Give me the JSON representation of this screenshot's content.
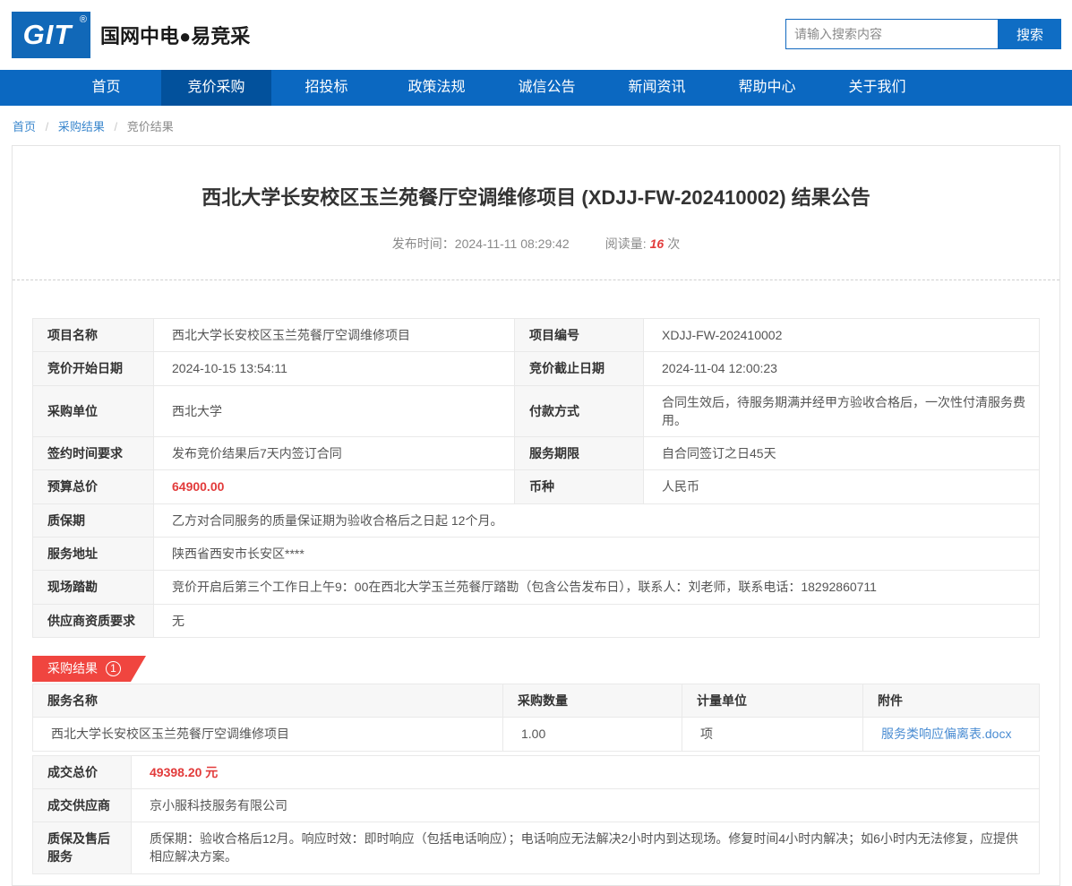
{
  "colors": {
    "nav_blue": "#0b68c1",
    "nav_active_blue": "#02519c",
    "logo_blue": "#1168b8",
    "accent_red": "#e23b3b",
    "ribbon_red": "#f0453f",
    "link_blue": "#4a8cd2"
  },
  "header": {
    "logo_text": "GIT",
    "logo_reg": "®",
    "brand": "国网中电●易竞采",
    "search_placeholder": "请输入搜索内容",
    "search_button": "搜索"
  },
  "nav": {
    "items": [
      {
        "label": "首页"
      },
      {
        "label": "竞价采购"
      },
      {
        "label": "招投标"
      },
      {
        "label": "政策法规"
      },
      {
        "label": "诚信公告"
      },
      {
        "label": "新闻资讯"
      },
      {
        "label": "帮助中心"
      },
      {
        "label": "关于我们"
      }
    ]
  },
  "breadcrumb": {
    "home": "首页",
    "sep1": "/",
    "middle": "采购结果",
    "sep2": "/",
    "current": "竞价结果"
  },
  "article": {
    "title": "西北大学长安校区玉兰苑餐厅空调维修项目 (XDJJ-FW-202410002) 结果公告",
    "publish_label": "发布时间：",
    "publish_time": "2024-11-11 08:29:42",
    "views_label": "阅读量:",
    "views_count": "16",
    "views_unit": "次"
  },
  "info": {
    "project_name_label": "项目名称",
    "project_name": "西北大学长安校区玉兰苑餐厅空调维修项目",
    "project_code_label": "项目编号",
    "project_code": "XDJJ-FW-202410002",
    "start_label": "竞价开始日期",
    "start": "2024-10-15 13:54:11",
    "end_label": "竞价截止日期",
    "end": "2024-11-04 12:00:23",
    "buyer_label": "采购单位",
    "buyer": "西北大学",
    "payment_label": "付款方式",
    "payment": "合同生效后，待服务期满并经甲方验收合格后，一次性付清服务费用。",
    "sign_label": "签约时间要求",
    "sign": "发布竞价结果后7天内签订合同",
    "service_period_label": "服务期限",
    "service_period": "自合同签订之日45天",
    "budget_label": "预算总价",
    "budget": "64900.00",
    "currency_label": "币种",
    "currency": "人民币",
    "warranty_label": "质保期",
    "warranty": "乙方对合同服务的质量保证期为验收合格后之日起 12个月。",
    "address_label": "服务地址",
    "address": "陕西省西安市长安区****",
    "survey_label": "现场踏勘",
    "survey": "竞价开启后第三个工作日上午9：00在西北大学玉兰苑餐厅踏勘（包含公告发布日），联系人：刘老师，联系电话：18292860711",
    "qualification_label": "供应商资质要求",
    "qualification": "无"
  },
  "result": {
    "badge_label": "采购结果",
    "badge_num": "1",
    "headers": [
      "服务名称",
      "采购数量",
      "计量单位",
      "附件"
    ],
    "row": {
      "name": "西北大学长安校区玉兰苑餐厅空调维修项目",
      "qty": "1.00",
      "unit": "项",
      "attachment": "服务类响应偏离表.docx"
    },
    "total_label": "成交总价",
    "total_value": "49398.20 元",
    "supplier_label": "成交供应商",
    "supplier": "京小服科技服务有限公司",
    "aftersale_label": "质保及售后服务",
    "aftersale": "质保期：验收合格后12月。响应时效：即时响应（包括电话响应）；电话响应无法解决2小时内到达现场。修复时间4小时内解决；如6小时内无法修复，应提供相应解决方案。"
  }
}
